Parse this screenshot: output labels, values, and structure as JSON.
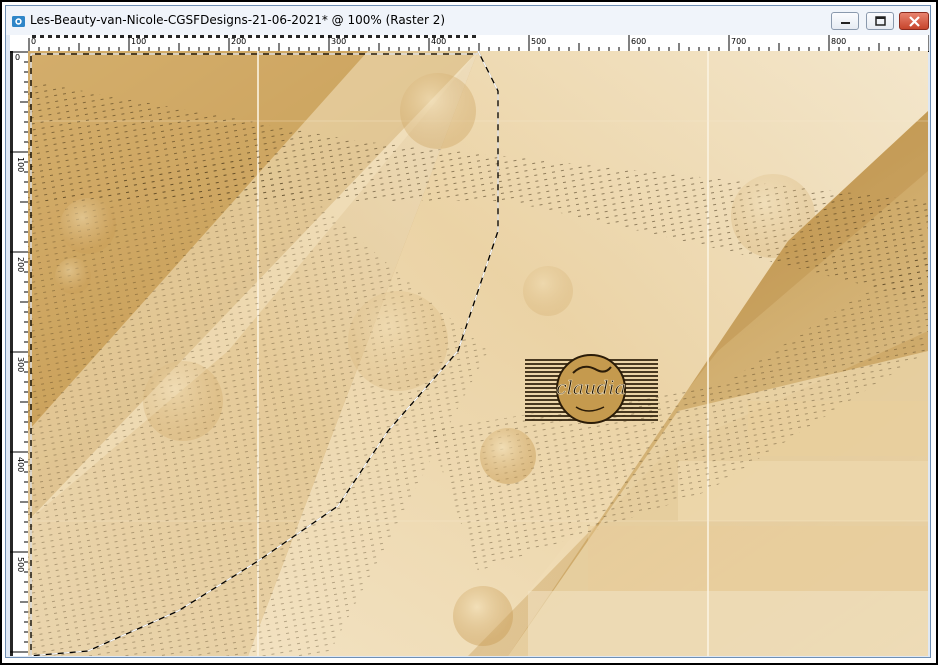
{
  "window": {
    "title": "Les-Beauty-van-Nicole-CGSFDesigns-21-06-2021* @ 100% (Raster 2)",
    "icon": "camera-icon"
  },
  "buttons": {
    "minimize": "minimize-icon",
    "maximize": "maximize-icon",
    "close": "close-icon"
  },
  "ruler": {
    "top_labels": [
      "0",
      "100",
      "200",
      "300",
      "400",
      "500",
      "600",
      "700",
      "800"
    ],
    "left_labels": [
      "0",
      "100",
      "200",
      "300",
      "400",
      "500"
    ]
  },
  "canvas": {
    "watermark_text": "claudia"
  },
  "colors": {
    "accent_gold": "#b88b40",
    "light_cream": "#f3e2bf",
    "close_red": "#c6452c"
  }
}
